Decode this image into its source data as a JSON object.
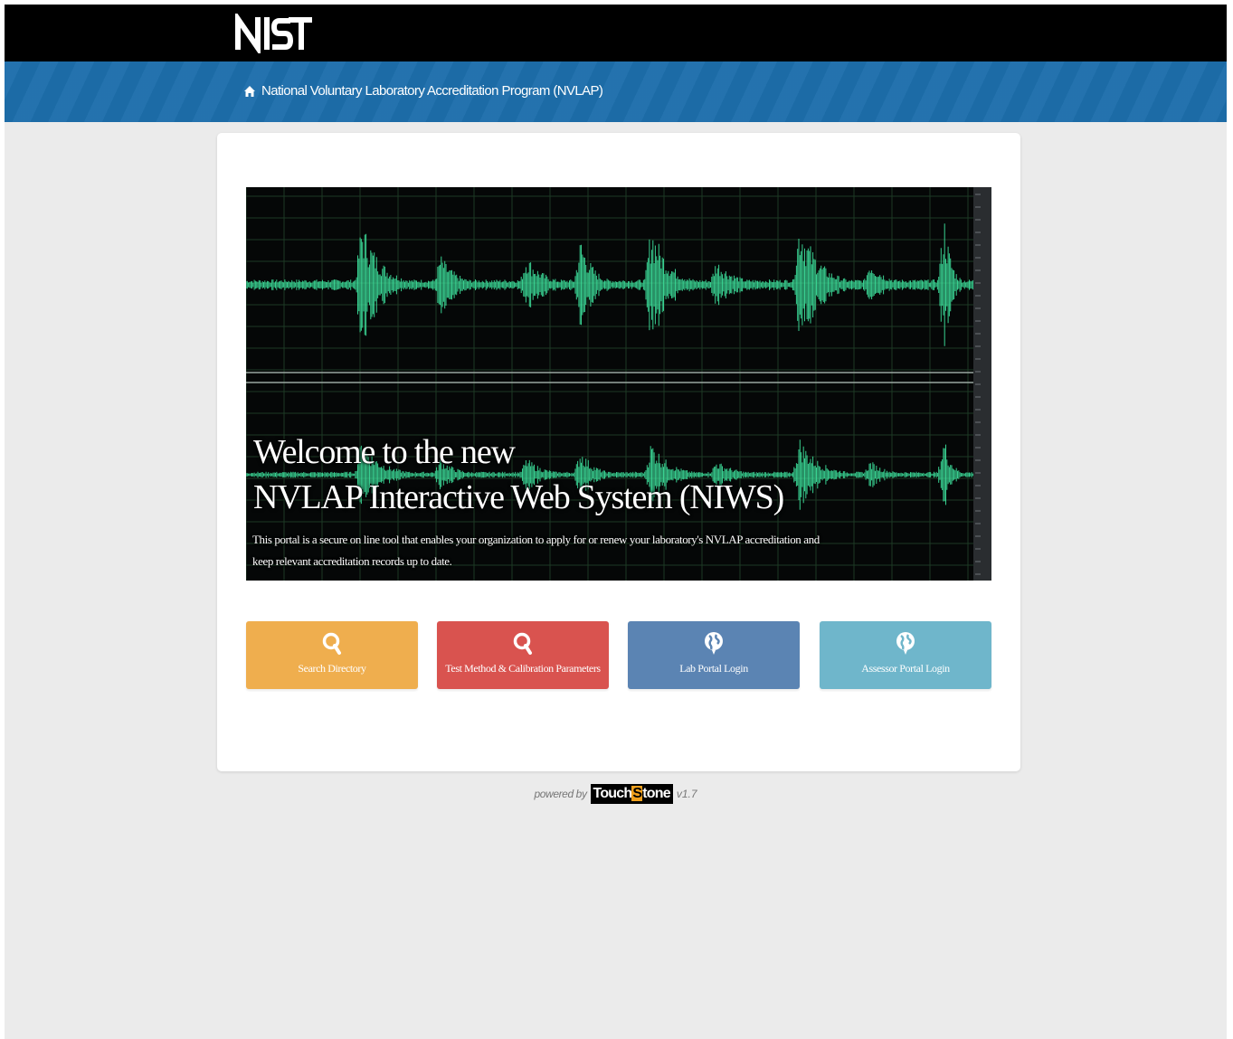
{
  "header": {
    "logo_text": "NIST",
    "nav_link_label": "National Voluntary Laboratory Accreditation Program (NVLAP)",
    "nav_icon": "home-icon"
  },
  "hero": {
    "title_line1": "Welcome to the new",
    "title_line2": "NVLAP Interactive Web System (NIWS)",
    "description": "This portal is a secure on line tool that enables your organization to apply for or renew your laboratory's NVLAP accreditation and keep relevant accreditation records up to date."
  },
  "buttons": [
    {
      "label": "Search Directory",
      "icon": "search-icon",
      "color": "#efae4e"
    },
    {
      "label": "Test Method & Calibration Parameters",
      "icon": "search-icon",
      "color": "#d9534f"
    },
    {
      "label": "Lab Portal Login",
      "icon": "globe-icon",
      "color": "#5b84b3"
    },
    {
      "label": "Assessor Portal Login",
      "icon": "globe-icon",
      "color": "#6fb6cb"
    }
  ],
  "footer": {
    "powered_by": "powered by",
    "brand_prefix": "Touch",
    "brand_mark": "S",
    "brand_suffix": "tone",
    "version": "v1.7"
  },
  "colors": {
    "top_bar": "#000000",
    "nav_bar": "#1d6eab",
    "background": "#ebebeb",
    "waveform": "#3ee6a0"
  }
}
